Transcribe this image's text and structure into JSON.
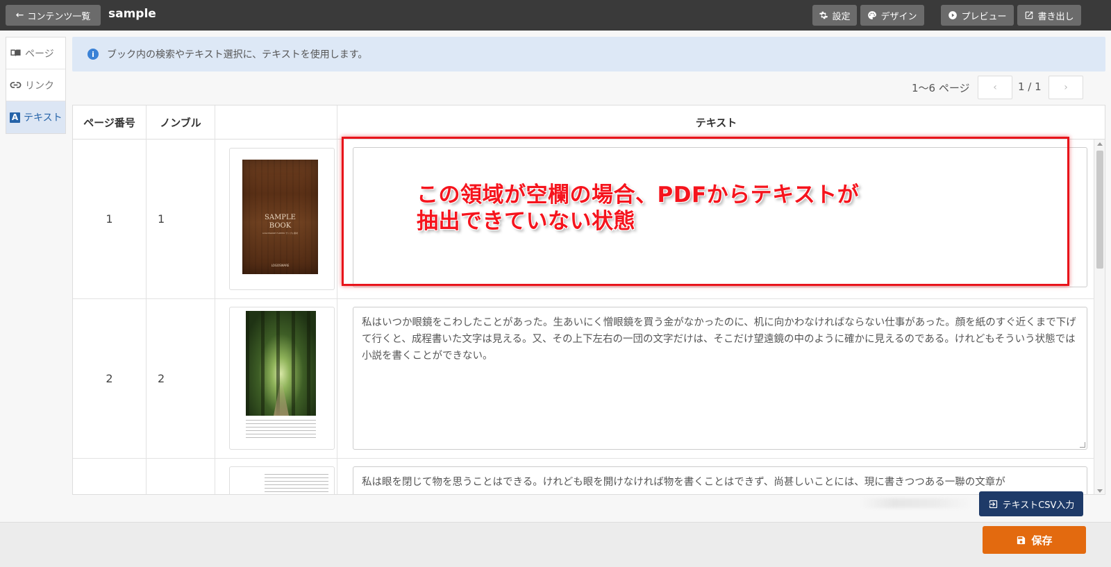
{
  "topbar": {
    "back_label": "コンテンツ一覧",
    "title": "sample",
    "settings_label": "設定",
    "design_label": "デザイン",
    "preview_label": "プレビュー",
    "export_label": "書き出し"
  },
  "sidebar": {
    "items": [
      {
        "label": "ページ",
        "icon": "book-icon"
      },
      {
        "label": "リンク",
        "icon": "link-icon"
      },
      {
        "label": "テキスト",
        "icon": "text-a-icon"
      }
    ],
    "active_index": 2
  },
  "info": {
    "message": "ブック内の検索やテキスト選択に、テキストを使用します。"
  },
  "pagination": {
    "range_label": "1〜6 ページ",
    "prev": "‹",
    "current": "1 / 1",
    "next": "›"
  },
  "table": {
    "headers": [
      "ページ番号",
      "ノンブル",
      "",
      "テキスト"
    ],
    "rows": [
      {
        "page_no": "1",
        "nombre": "1",
        "thumb_title": "SAMPLE BOOK",
        "thumb_subtitle": "LOGOSWARE FLIPPER サンプル素材",
        "thumb_logo": "LOGOSWARE",
        "text": ""
      },
      {
        "page_no": "2",
        "nombre": "2",
        "text": "私はいつか眼鏡をこわしたことがあった。生あいにく憎眼鏡を買う金がなかったのに、机に向かわなければならない仕事があった。顔を紙のすぐ近くまで下げて行くと、成程書いた文字は見える。又、その上下左右の一団の文字だけは、そこだけ望遠鏡の中のように確かに見えるのである。けれどもそういう状態では小説を書くことができない。"
      },
      {
        "page_no": "",
        "nombre": "",
        "text": "私は眼を閉じて物を思うことはできる。けれども眼を開けなければ物を書くことはできず、尚甚しいことには、現に書きつつある一聯の文章が"
      }
    ]
  },
  "annotation": {
    "line1": "この領域が空欄の場合、PDFからテキストが",
    "line2": "抽出できていない状態"
  },
  "actions": {
    "csv_import_label": "テキストCSV入力",
    "save_label": "保存"
  },
  "colors": {
    "topbar": "#3a3a3a",
    "accent_blue": "#2563a8",
    "info_bg": "#dde8f6",
    "csv_button": "#1e3a68",
    "save_button": "#e36a0f",
    "annotation_red": "#e8131a"
  }
}
